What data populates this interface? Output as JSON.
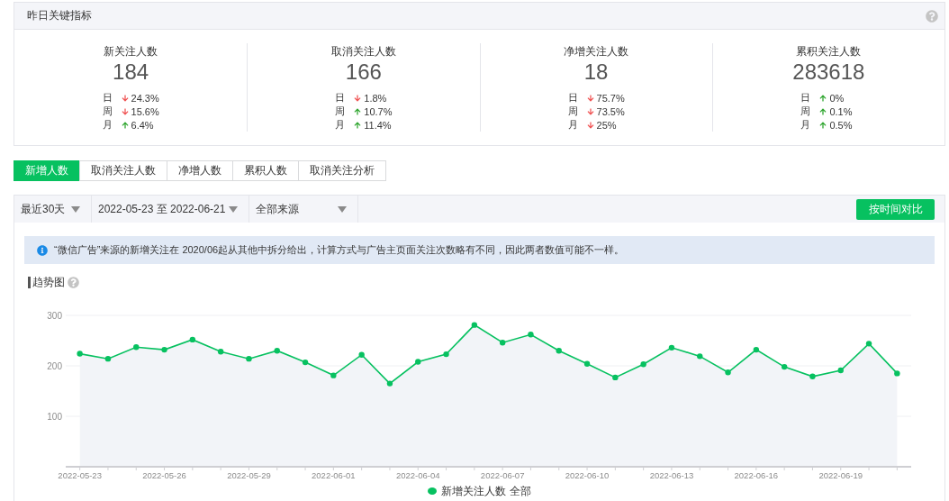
{
  "key_metrics": {
    "title": "昨日关键指标",
    "metrics": [
      {
        "label": "新关注人数",
        "value": "184",
        "changes": [
          {
            "period": "日",
            "increase": false,
            "change": "24.3%"
          },
          {
            "period": "周",
            "increase": false,
            "change": "15.6%"
          },
          {
            "period": "月",
            "increase": true,
            "change": "6.4%"
          }
        ]
      },
      {
        "label": "取消关注人数",
        "value": "166",
        "changes": [
          {
            "period": "日",
            "increase": false,
            "change": "1.8%"
          },
          {
            "period": "周",
            "increase": true,
            "change": "10.7%"
          },
          {
            "period": "月",
            "increase": true,
            "change": "11.4%"
          }
        ]
      },
      {
        "label": "净增关注人数",
        "value": "18",
        "changes": [
          {
            "period": "日",
            "increase": false,
            "change": "75.7%"
          },
          {
            "period": "周",
            "increase": false,
            "change": "73.5%"
          },
          {
            "period": "月",
            "increase": false,
            "change": "25%"
          }
        ]
      },
      {
        "label": "累积关注人数",
        "value": "283618",
        "changes": [
          {
            "period": "日",
            "increase": true,
            "change": "0%"
          },
          {
            "period": "周",
            "increase": true,
            "change": "0.1%"
          },
          {
            "period": "月",
            "increase": true,
            "change": "0.5%"
          }
        ]
      }
    ]
  },
  "tabs": [
    {
      "label": "新增人数",
      "selected": true
    },
    {
      "label": "取消关注人数",
      "selected": false
    },
    {
      "label": "净增人数",
      "selected": false
    },
    {
      "label": "累积人数",
      "selected": false
    },
    {
      "label": "取消关注分析",
      "selected": false
    }
  ],
  "filters": {
    "dropdowns": [
      {
        "value": "最近30天"
      },
      {
        "value": "2022-05-23 至 2022-06-21"
      },
      {
        "value": "全部来源"
      }
    ],
    "compare_button": "按时间对比"
  },
  "notice": "“微信广告”来源的新增关注在 2020/06起从其他中拆分给出，计算方式与广告主页面关注次数略有不同，因此两者数值可能不一样。",
  "trend": {
    "title": "趋势图",
    "chart_data": {
      "type": "area",
      "categories": [
        "2022-05-23",
        null,
        null,
        "2022-05-26",
        null,
        null,
        "2022-05-29",
        null,
        null,
        "2022-06-01",
        null,
        null,
        "2022-06-04",
        null,
        null,
        "2022-06-07",
        null,
        null,
        "2022-06-10",
        null,
        null,
        "2022-06-13",
        null,
        null,
        "2022-06-16",
        null,
        null,
        "2022-06-19",
        null,
        null
      ],
      "series": [
        {
          "name": "新增关注人数 全部",
          "color": "#07c160",
          "values": [
            224,
            214,
            237,
            232,
            252,
            228,
            214,
            230,
            207,
            181,
            222,
            165,
            208,
            223,
            281,
            246,
            262,
            230,
            204,
            177,
            203,
            236,
            219,
            187,
            232,
            198,
            179,
            191,
            244,
            185
          ]
        }
      ],
      "ylim": [
        0,
        300
      ],
      "yticks": [
        100,
        200,
        300
      ]
    }
  }
}
